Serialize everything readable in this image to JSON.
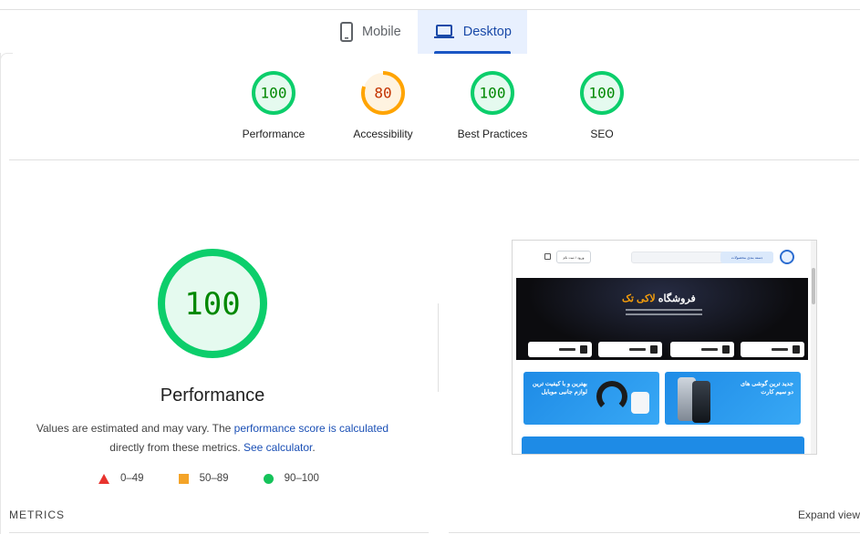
{
  "tabs": [
    {
      "label": "Mobile",
      "icon": "smartphone-icon",
      "active": false
    },
    {
      "label": "Desktop",
      "icon": "laptop-icon",
      "active": true
    }
  ],
  "categories": [
    {
      "score": "100",
      "label": "Performance",
      "value": 100,
      "color": "#0cce6b",
      "text_color": "#008800",
      "fill": "#e5faef"
    },
    {
      "score": "80",
      "label": "Accessibility",
      "value": 80,
      "color": "#ffa400",
      "text_color": "#c33300",
      "fill": "#fff3e0"
    },
    {
      "score": "100",
      "label": "Best Practices",
      "value": 100,
      "color": "#0cce6b",
      "text_color": "#008800",
      "fill": "#e5faef"
    },
    {
      "score": "100",
      "label": "SEO",
      "value": 100,
      "color": "#0cce6b",
      "text_color": "#008800",
      "fill": "#e5faef"
    }
  ],
  "performance": {
    "score": "100",
    "value": 100,
    "title": "Performance",
    "desc_prefix": "Values are estimated and may vary. The ",
    "desc_link1": "performance score is calculated",
    "desc_middle": " directly from these metrics. ",
    "desc_link2": "See calculator",
    "desc_suffix": "."
  },
  "legend": [
    {
      "label": "0–49",
      "shape": "triangle",
      "color": "#ff3333"
    },
    {
      "label": "50–89",
      "shape": "square",
      "color": "#ffa400"
    },
    {
      "label": "90–100",
      "shape": "circle",
      "color": "#0cce6b"
    }
  ],
  "screenshot": {
    "hero_title_prefix": "فروشگاه",
    "hero_title_brand": "لاکی تک",
    "banner_right": "جدید ترین گوشی های دو سیم کارت",
    "banner_left": "بهترین و با کیفیت ترین لوازم جانبی موبایل",
    "login_label": "ورود / ثبت نام",
    "search_button": "دسته بندی محصولات"
  },
  "footer": {
    "metrics_label": "METRICS",
    "expand_label": "Expand view"
  }
}
